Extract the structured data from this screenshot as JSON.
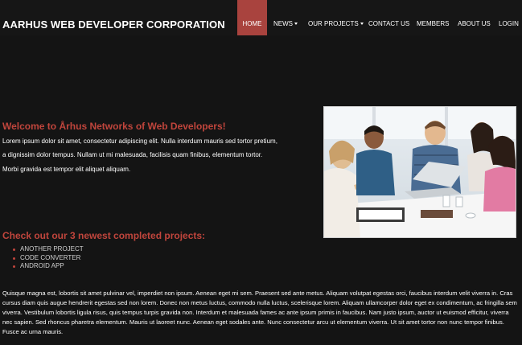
{
  "brand": "AARHUS WEB DEVELOPER CORPORATION",
  "nav": {
    "items": [
      {
        "label": "HOME",
        "active": true,
        "dropdown": false
      },
      {
        "label": "NEWS",
        "active": false,
        "dropdown": true
      },
      {
        "label": "OUR PROJECTS",
        "active": false,
        "dropdown": true
      },
      {
        "label": "CONTACT US",
        "active": false,
        "dropdown": false
      },
      {
        "label": "MEMBERS",
        "active": false,
        "dropdown": false
      },
      {
        "label": "ABOUT US",
        "active": false,
        "dropdown": false
      },
      {
        "label": "LOGIN",
        "active": false,
        "dropdown": false
      }
    ]
  },
  "welcome": {
    "title": "Welcome to Århus Networks of Web Developers!",
    "lines": [
      "Lorem ipsum dolor sit amet, consectetur adipiscing elit. Nulla interdum mauris sed tortor pretium,",
      "a dignissim dolor tempus.  Nullam ut mi malesuada, facilisis quam finibus, elementum tortor.",
      "Morbi gravida est tempor elit aliquet aliquam."
    ]
  },
  "projects": {
    "heading": "Check out our 3 newest completed projects:",
    "items": [
      "ANOTHER PROJECT",
      "CODE CONVERTER",
      "ANDROID APP"
    ]
  },
  "bottom_text": "Quisque magna est, lobortis sit amet pulvinar vel, imperdiet non ipsum. Aenean eget mi sem. Praesent sed ante metus. Aliquam volutpat egestas orci, faucibus interdum velit viverra in. Cras cursus diam quis augue hendrerit egestas sed non lorem. Donec non metus luctus, commodo nulla luctus, scelerisque lorem. Aliquam ullamcorper dolor eget ex condimentum, ac fringilla sem viverra. Vestibulum lobortis ligula risus, quis tempus turpis gravida non. Interdum et malesuada fames ac ante ipsum primis in faucibus. Nam justo ipsum, auctor ut euismod efficitur, viverra nec sapien. Sed rhoncus pharetra elementum. Mauris ut laoreet nunc. Aenean eget sodales ante. Nunc consectetur arcu ut elementum viverra. Ut sit amet tortor non nunc tempor finibus. Fusce ac urna mauris.",
  "colors": {
    "accent": "#c0453c",
    "active_nav": "#a9433e",
    "background": "#141414"
  }
}
